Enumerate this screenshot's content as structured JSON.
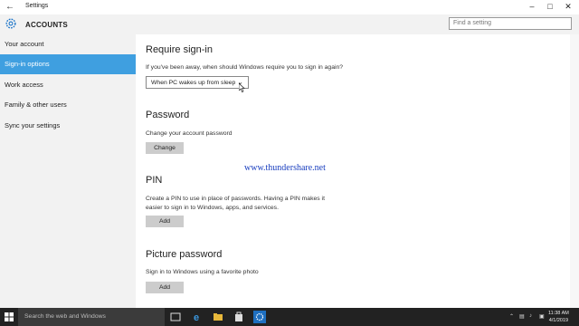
{
  "window": {
    "title": "Settings"
  },
  "header": {
    "app_title": "ACCOUNTS"
  },
  "search": {
    "placeholder": "Find a setting"
  },
  "sidebar": {
    "items": [
      {
        "label": "Your account",
        "active": false
      },
      {
        "label": "Sign-in options",
        "active": true
      },
      {
        "label": "Work access",
        "active": false
      },
      {
        "label": "Family & other users",
        "active": false
      },
      {
        "label": "Sync your settings",
        "active": false
      }
    ]
  },
  "content": {
    "require_signin": {
      "heading": "Require sign-in",
      "question": "If you've been away, when should Windows require you to sign in again?",
      "selected": "When PC wakes up from sleep"
    },
    "password": {
      "heading": "Password",
      "description": "Change your account password",
      "button": "Change"
    },
    "watermark": "www.thundershare.net",
    "pin": {
      "heading": "PIN",
      "description_line1": "Create a PIN to use in place of passwords. Having a PIN makes it",
      "description_line2": "easier to sign in to Windows, apps, and services.",
      "button": "Add"
    },
    "picture_password": {
      "heading": "Picture password",
      "description": "Sign in to Windows using a favorite photo",
      "button": "Add"
    }
  },
  "taskbar": {
    "search_placeholder": "Search the web and Windows",
    "time": "11:38 AM",
    "date": "4/1/2019"
  },
  "colors": {
    "accent": "#3f9fe0",
    "sidebar_bg": "#f2f2f2",
    "taskbar_bg": "#222222"
  }
}
